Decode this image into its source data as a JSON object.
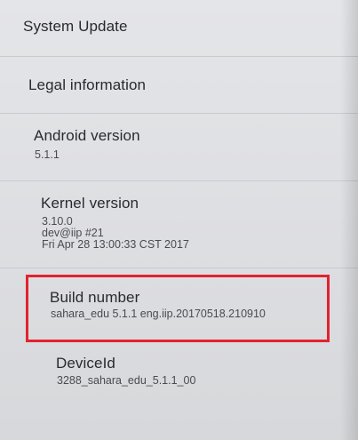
{
  "settings": {
    "items": [
      {
        "key": "system_update",
        "title": "System Update"
      },
      {
        "key": "legal_information",
        "title": "Legal information"
      },
      {
        "key": "android_version",
        "title": "Android version",
        "summary": [
          "5.1.1"
        ]
      },
      {
        "key": "kernel_version",
        "title": "Kernel version",
        "summary": [
          "3.10.0",
          "dev@iip #21",
          "Fri Apr 28 13:00:33 CST 2017"
        ]
      },
      {
        "key": "build_number",
        "title": "Build number",
        "summary": [
          "sahara_edu 5.1.1 eng.iip.20170518.210910"
        ]
      },
      {
        "key": "device_id",
        "title": "DeviceId",
        "summary": [
          "3288_sahara_edu_5.1.1_00"
        ]
      }
    ]
  },
  "colors": {
    "highlight": "#e2232e",
    "background": "#e0e1e4"
  }
}
